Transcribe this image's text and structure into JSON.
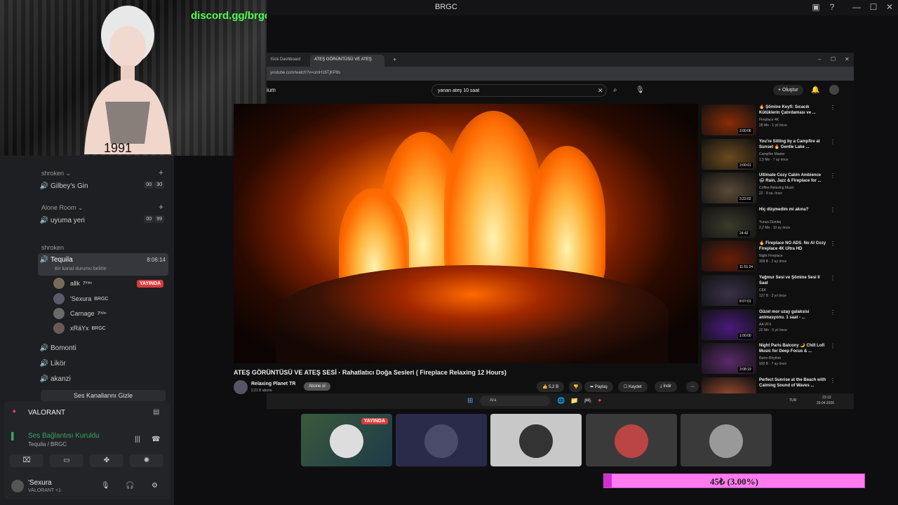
{
  "window": {
    "title": "BRGC"
  },
  "webcam": {
    "discord": "discord.gg/brgc"
  },
  "discord": {
    "sections": [
      {
        "name": "shroken ⌄"
      },
      {
        "name": "Alone Room ⌄"
      },
      {
        "name": "shroken"
      }
    ],
    "channels": [
      {
        "name": "Gilbey's Gin",
        "a": "00",
        "b": "30"
      },
      {
        "name": "uyuma yeri",
        "a": "00",
        "b": "99"
      },
      {
        "name": "Tequila",
        "time": "8:06:14",
        "status": "Bir kanal durumu belirle"
      },
      {
        "name": "Bomonti"
      },
      {
        "name": "Likör"
      },
      {
        "name": "akanzi"
      }
    ],
    "voice_users": [
      {
        "name": "aⅡk",
        "tag": "7ᵐᵃⁿ",
        "live": "YAYINDA"
      },
      {
        "name": "'Sexura",
        "tag": "BRGC"
      },
      {
        "name": "Carnage",
        "tag": "7ᵐᵃⁿ"
      },
      {
        "name": "xRäYx",
        "tag": "BRGC"
      }
    ],
    "hidden_label": "Ses Kanallarını Gizle",
    "panel": {
      "game": "VALORANT",
      "conn": "Ses Bağlantısı Kuruldu",
      "conn_sub": "Tequila / BRGC",
      "user": "'Sexura",
      "user_sub": "VALORANT +1"
    }
  },
  "browser": {
    "tabs": [
      "Kick Dashboard",
      "ATEŞ GÖRÜNTÜSÜ VE ATEŞ"
    ],
    "url": "youtube.com/watch?v=umH16TjKP8s",
    "search": "yanan ateş 10 saat",
    "create": "+ Oluştur",
    "logo_fragment": "ium",
    "video_title": "ATEŞ GÖRÜNTÜSÜ VE ATEŞ SESİ - Rahatlatıcı Doğa Sesleri ( Fireplace Relaxing 12 Hours)",
    "channel": "Relaxing Planet TR",
    "subs": "2,21 B abone",
    "subscribe": "Abone ol",
    "likes": "5,2 B",
    "share": "Paylaş",
    "save": "Kaydet",
    "download": "İndir",
    "side": [
      {
        "title": "🔥 Şömine Keyfi: Sıcacık Kütüklerin Çatırdaması ve ...",
        "chan": "Fireplace 4K",
        "meta": "28 Mn · 1 yıl önce",
        "dur": "3:00:06",
        "color": "#8a2c06"
      },
      {
        "title": "You're Sitting by a Campfire at Sunset 🔥 Gentle Lake ...",
        "chan": "Campfire Master",
        "meta": "1,5 Mn · 7 ay önce",
        "dur": "3:00:01",
        "color": "#6b4a1e"
      },
      {
        "title": "Ultimate Cozy Cabin Ambience 🌧 Rain, Jazz & Fireplace for ...",
        "chan": "Coffee Relaxing Music",
        "meta": "22 · 8 sa. önce",
        "dur": "3:22:02",
        "color": "#5a4a38"
      },
      {
        "title": "Hiç düşmedim mi akına?",
        "chan": "Yunus Dümkq",
        "meta": "2,2 Mn · 10 ay önce",
        "dur": "24:42",
        "color": "#3b3a2a"
      },
      {
        "title": "🔥 Fireplace NO ADS. No AI Cozy Fireplace 4K Ultra HD",
        "chan": "Night Fireplace",
        "meta": "309 B · 2 ay önce",
        "dur": "11:51:24",
        "color": "#6a1e06"
      },
      {
        "title": "Yağmur Sesi ve Şömine Sesi ll Saat",
        "chan": "CEK",
        "meta": "127 B · 3 yıl önce",
        "dur": "8:07:01",
        "color": "#3a3048"
      },
      {
        "title": "Güzel mor uzay galaksisi animasyonu. 1 saat - ...",
        "chan": "AA VFX",
        "meta": "22 Mn · 5 yıl önce",
        "dur": "1:00:00",
        "color": "#4a1a7a"
      },
      {
        "title": "Night Paris Balcony 🌙 Chill Lofi Music for Deep Focus & ...",
        "chan": "Retro-Rhythm",
        "meta": "920 B · 7 ay önce",
        "dur": "3:08:19",
        "color": "#5a2a6a"
      },
      {
        "title": "Perfect Sunrise at the Beach with Calming Sound of Waves ...",
        "chan": "",
        "meta": "",
        "dur": "",
        "color": "#9a4a30"
      }
    ],
    "taskbar": {
      "search": "Ara",
      "lang": "TUR",
      "time": "23:13",
      "date": "29.04.2026"
    }
  },
  "cams": {
    "live": "YAYINDA"
  },
  "donation": {
    "text": "45₺ (3.00%)",
    "progress": 3
  }
}
